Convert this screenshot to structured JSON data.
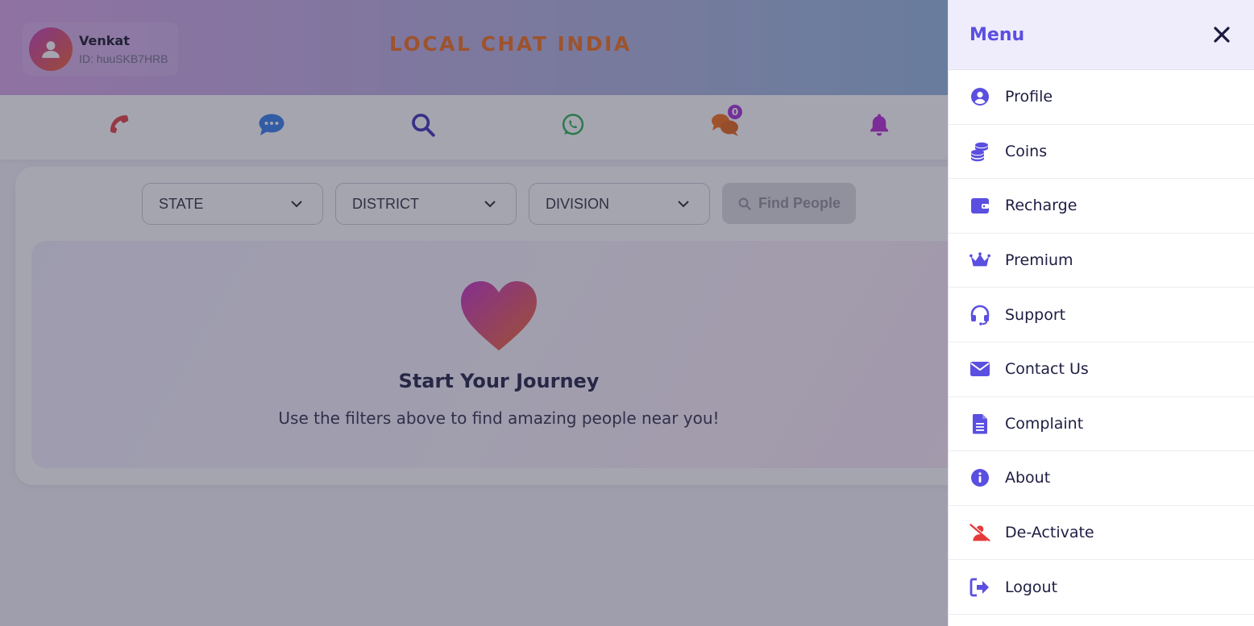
{
  "header": {
    "user_name": "Venkat",
    "user_id": "ID: huuSKB7HRB",
    "app_title": "LOCAL CHAT INDIA"
  },
  "icon_bar": {
    "icons": [
      "phone-icon",
      "chat-bubble-icon",
      "search-icon",
      "whatsapp-icon",
      "comments-icon",
      "bell-icon"
    ],
    "comments_badge": "0",
    "colors": {
      "phone": "#e33b3b",
      "chat": "#2f7be8",
      "search": "#3a2db5",
      "whatsapp": "#25b04a",
      "comments": "#f26b12",
      "bell": "#b424d0"
    }
  },
  "filters": {
    "state": "STATE",
    "district": "DISTRICT",
    "division": "DIVISION",
    "find_button": "Find People"
  },
  "empty_state": {
    "title": "Start Your Journey",
    "subtitle": "Use the filters above to find amazing people near you!"
  },
  "menu": {
    "title": "Menu",
    "accent": "#5a4fe0",
    "items": [
      {
        "label": "Profile",
        "icon": "user-circle-icon"
      },
      {
        "label": "Coins",
        "icon": "coins-icon"
      },
      {
        "label": "Recharge",
        "icon": "wallet-icon"
      },
      {
        "label": "Premium",
        "icon": "crown-icon"
      },
      {
        "label": "Support",
        "icon": "headset-icon"
      },
      {
        "label": "Contact Us",
        "icon": "envelope-icon"
      },
      {
        "label": "Complaint",
        "icon": "file-icon"
      },
      {
        "label": "About",
        "icon": "info-icon"
      },
      {
        "label": "De-Activate",
        "icon": "user-slash-icon"
      },
      {
        "label": "Logout",
        "icon": "logout-icon"
      }
    ]
  }
}
